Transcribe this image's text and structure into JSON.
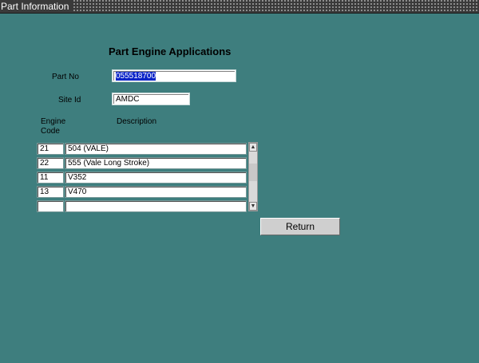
{
  "window": {
    "title": "Part Information"
  },
  "form": {
    "heading": "Part Engine Applications",
    "part_no_label": "Part No",
    "part_no_value": "055518700",
    "site_id_label": "Site Id",
    "site_id_value": "AMDC"
  },
  "table": {
    "col_engine_line1": "Engine",
    "col_engine_line2": "Code",
    "col_description": "Description",
    "rows": [
      {
        "code": "21",
        "description": "504 (VALE)"
      },
      {
        "code": "22",
        "description": "555 (Vale Long Stroke)"
      },
      {
        "code": "11",
        "description": "V352"
      },
      {
        "code": "13",
        "description": "V470"
      },
      {
        "code": "",
        "description": ""
      }
    ]
  },
  "buttons": {
    "return_label": "Return"
  },
  "icons": {
    "scroll_up": "scroll-up-arrow-icon",
    "scroll_down": "scroll-down-arrow-icon"
  },
  "colors": {
    "background": "#3e7e7e",
    "selection": "#0a24c8"
  }
}
